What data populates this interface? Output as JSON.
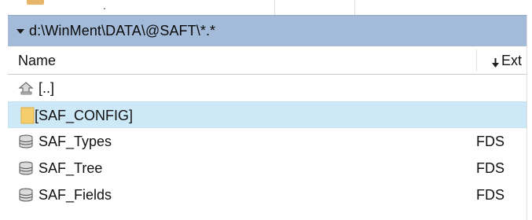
{
  "path_bar": {
    "path": "d:\\WinMent\\DATA\\@SAFT\\*.*",
    "dropdown_icon": "triangle-down-icon"
  },
  "columns": {
    "name": "Name",
    "ext": "Ext",
    "ext_sort_icon": "sort-down-arrow-icon"
  },
  "rows": [
    {
      "icon": "up-folder-icon",
      "name": "[..]",
      "ext": "",
      "selected": false
    },
    {
      "icon": "folder-icon",
      "name": "[SAF_CONFIG]",
      "ext": "",
      "selected": true
    },
    {
      "icon": "database-icon",
      "name": "SAF_Types",
      "ext": "FDS",
      "selected": false
    },
    {
      "icon": "database-icon",
      "name": "SAF_Tree",
      "ext": "FDS",
      "selected": false
    },
    {
      "icon": "database-icon",
      "name": "SAF_Fields",
      "ext": "FDS",
      "selected": false
    }
  ],
  "colors": {
    "path_bar_bg": "#a3bbd8",
    "selected_row_bg": "#cde8f7",
    "folder_yellow": "#f5cd6a"
  }
}
